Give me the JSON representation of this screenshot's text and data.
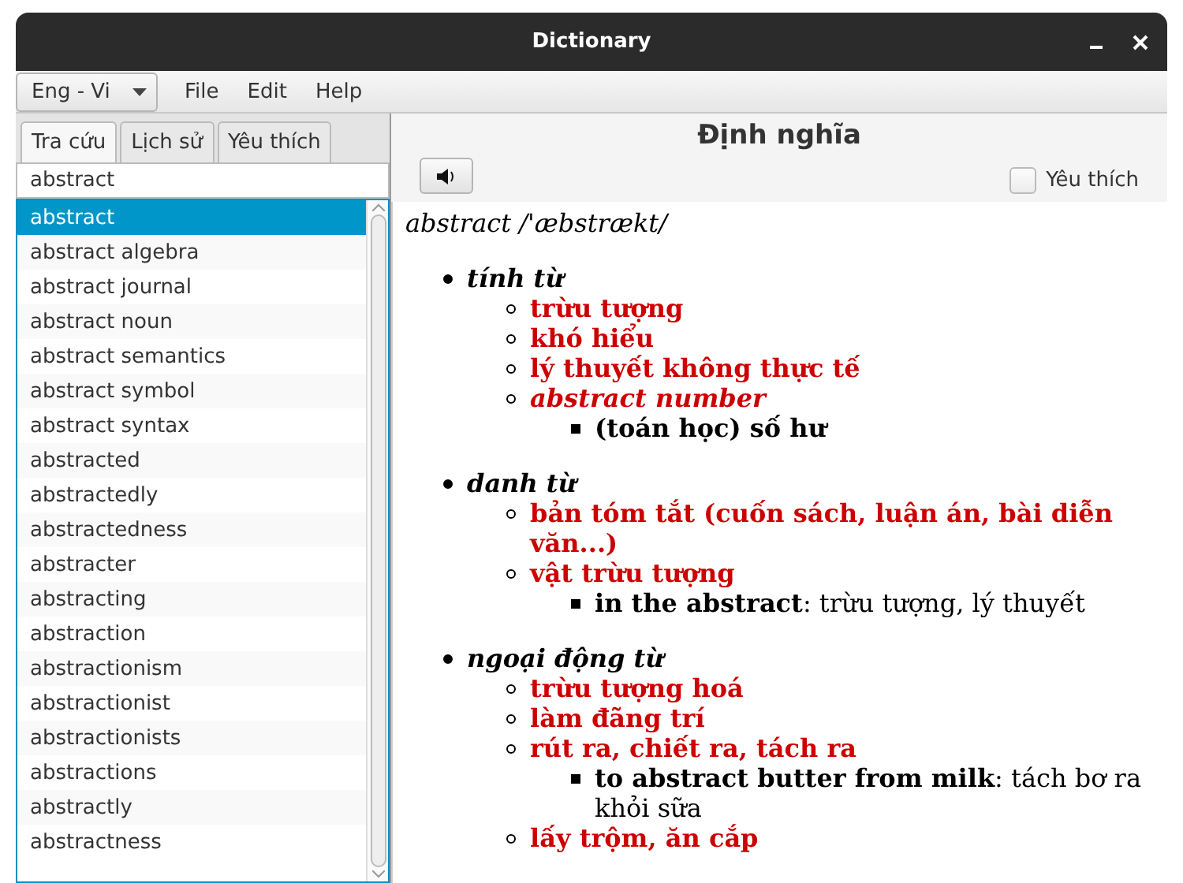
{
  "window": {
    "title": "Dictionary"
  },
  "menubar": {
    "language_selector": {
      "value": "Eng - Vi"
    },
    "menus": [
      "File",
      "Edit",
      "Help"
    ]
  },
  "tabs": [
    {
      "label": "Tra cứu",
      "selected": true
    },
    {
      "label": "Lịch sử",
      "selected": false
    },
    {
      "label": "Yêu thích",
      "selected": false
    }
  ],
  "search": {
    "value": "abstract"
  },
  "word_list": [
    {
      "text": "abstract",
      "selected": true
    },
    {
      "text": "abstract algebra",
      "selected": false
    },
    {
      "text": "abstract journal",
      "selected": false
    },
    {
      "text": "abstract noun",
      "selected": false
    },
    {
      "text": "abstract semantics",
      "selected": false
    },
    {
      "text": "abstract symbol",
      "selected": false
    },
    {
      "text": "abstract syntax",
      "selected": false
    },
    {
      "text": "abstracted",
      "selected": false
    },
    {
      "text": "abstractedly",
      "selected": false
    },
    {
      "text": "abstractedness",
      "selected": false
    },
    {
      "text": "abstracter",
      "selected": false
    },
    {
      "text": "abstracting",
      "selected": false
    },
    {
      "text": "abstraction",
      "selected": false
    },
    {
      "text": "abstractionism",
      "selected": false
    },
    {
      "text": "abstractionist",
      "selected": false
    },
    {
      "text": "abstractionists",
      "selected": false
    },
    {
      "text": "abstractions",
      "selected": false
    },
    {
      "text": "abstractly",
      "selected": false
    },
    {
      "text": "abstractness",
      "selected": false
    }
  ],
  "definition": {
    "heading": "Định nghĩa",
    "favorite": {
      "label": "Yêu thích",
      "checked": false
    },
    "headword": "abstract /'æbstrækt/",
    "entries": [
      {
        "part_of_speech": "tính từ",
        "senses": [
          {
            "kind": "meaning",
            "text": "trừu tượng"
          },
          {
            "kind": "meaning",
            "text": "khó hiểu"
          },
          {
            "kind": "meaning",
            "text": "lý thuyết không thực tế"
          },
          {
            "kind": "phrase",
            "text": "abstract number",
            "examples": [
              {
                "text": "**(toán học) số hư**"
              }
            ]
          }
        ]
      },
      {
        "part_of_speech": "danh từ",
        "senses": [
          {
            "kind": "meaning",
            "text": "bản tóm tắt (cuốn sách, luận án, bài diễn văn...)"
          },
          {
            "kind": "meaning",
            "text": "vật trừu tượng",
            "examples": [
              {
                "text": "**in the abstract**: trừu tượng, lý thuyết"
              }
            ]
          }
        ]
      },
      {
        "part_of_speech": "ngoại động từ",
        "senses": [
          {
            "kind": "meaning",
            "text": "trừu tượng hoá"
          },
          {
            "kind": "meaning",
            "text": "làm đãng trí"
          },
          {
            "kind": "meaning",
            "text": "rút ra, chiết ra, tách ra",
            "examples": [
              {
                "text": "**to abstract butter from milk**: tách bơ ra khỏi sữa"
              }
            ]
          },
          {
            "kind": "meaning",
            "text": "lấy trộm, ăn cắp"
          }
        ]
      }
    ]
  }
}
